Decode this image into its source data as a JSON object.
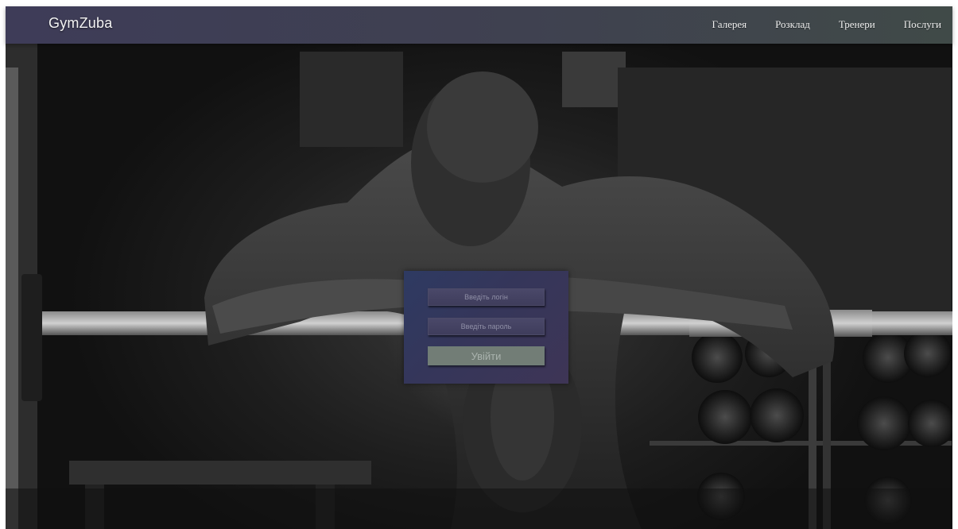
{
  "header": {
    "brand": "GymZuba",
    "nav": [
      {
        "label": "Галерея"
      },
      {
        "label": "Розклад"
      },
      {
        "label": "Тренери"
      },
      {
        "label": "Послуги"
      }
    ]
  },
  "login": {
    "login_placeholder": "Введіть логін",
    "password_placeholder": "Введіть пароль",
    "submit_label": "Увійти"
  },
  "colors": {
    "navbar": "#3f4150",
    "login_panel": "#35365a",
    "submit_button": "#727d76"
  }
}
